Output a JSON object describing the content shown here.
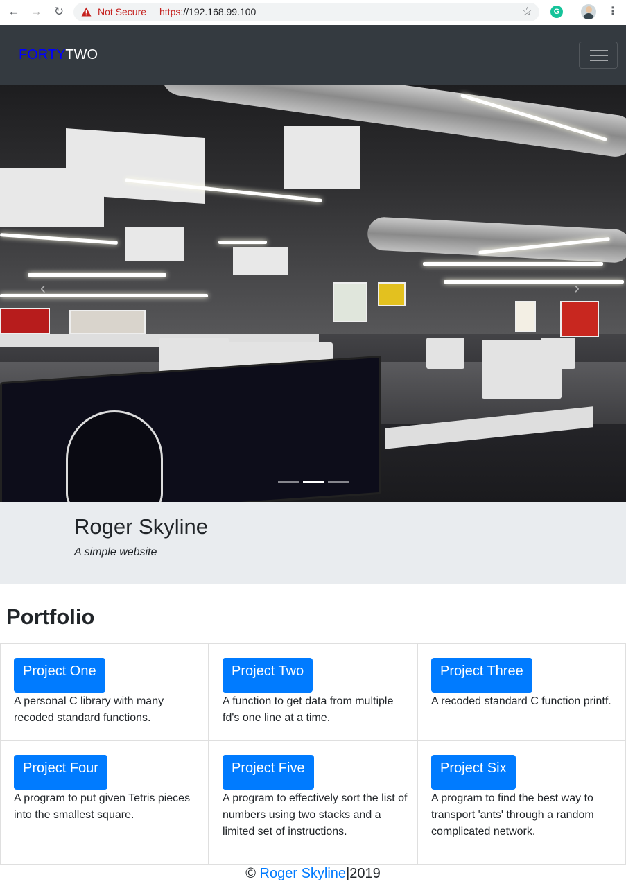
{
  "browser": {
    "back_glyph": "←",
    "forward_glyph": "→",
    "reload_glyph": "↻",
    "security_label": "Not Secure",
    "url_scheme": "https:",
    "url_rest": "//192.168.99.100",
    "star_glyph": "☆",
    "extension_glyph": "G",
    "menu_glyph": "⋮"
  },
  "navbar": {
    "brand_part1": "FORTY",
    "brand_part2": "TWO",
    "brand_colors": {
      "part1": "#0000ff",
      "part2": "#ffffff"
    },
    "background": "#343a40"
  },
  "carousel": {
    "prev_glyph": "‹",
    "next_glyph": "›",
    "slide_count": 3,
    "active_slide": 2
  },
  "jumbotron": {
    "title": "Roger Skyline",
    "subtitle": "A simple website"
  },
  "portfolio": {
    "heading": "Portfolio",
    "button_color": "#007bff",
    "projects": [
      {
        "label": "Project One",
        "description": "A personal C library with many recoded standard functions."
      },
      {
        "label": "Project Two",
        "description": "A function to get data from multiple fd's one line at a time."
      },
      {
        "label": "Project Three",
        "description": "A recoded standard C function printf."
      },
      {
        "label": "Project Four",
        "description": "A program to put given Tetris pieces into the smallest square."
      },
      {
        "label": "Project Five",
        "description": "A program to effectively sort the list of numbers using two stacks and a limited set of instructions."
      },
      {
        "label": "Project Six",
        "description": "A program to find the best way to transport 'ants' through a random complicated network."
      }
    ]
  },
  "footer": {
    "copyright_symbol": "©",
    "link_text": "Roger Skyline",
    "year_text": "|2019"
  }
}
